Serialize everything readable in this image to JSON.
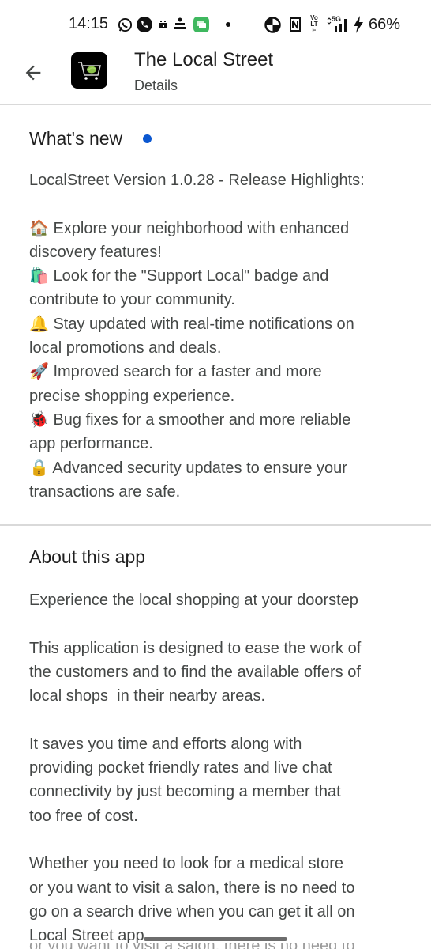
{
  "status_bar": {
    "time": "14:15",
    "left_icons": [
      "whatsapp-icon",
      "phone-call-icon",
      "recorder-icon",
      "game-app-icon",
      "messages-icon",
      "more-notifications-dot-icon"
    ],
    "right_icons": [
      "data-saver-icon",
      "nfc-icon",
      "volte-icon",
      "5g-signal-icon",
      "charging-icon"
    ],
    "network": "5G",
    "volte": "Vo LTE",
    "battery": "66%"
  },
  "header": {
    "app_name": "The Local Street",
    "subtitle": "Details",
    "back_icon": "arrow-back-icon",
    "app_icon": "shopping-cart-icon"
  },
  "whats_new": {
    "title": "What's new",
    "indicator_color": "#0b57d0",
    "intro": "LocalStreet Version 1.0.28 - Release Highlights:",
    "highlights": [
      {
        "emoji": "🏠",
        "lines": [
          "Explore your neighborhood with enhanced",
          "discovery features!"
        ]
      },
      {
        "emoji": "🛍️",
        "lines": [
          "Look for the \"Support Local\" badge and",
          "contribute to your community."
        ]
      },
      {
        "emoji": "🔔",
        "lines": [
          "Stay updated with real-time notifications on",
          "local promotions and deals."
        ]
      },
      {
        "emoji": "🚀",
        "lines": [
          "Improved search for a faster and more",
          "precise shopping experience."
        ]
      },
      {
        "emoji": "🐞",
        "lines": [
          "Bug fixes for a smoother and more reliable",
          "app performance."
        ]
      },
      {
        "emoji": "🔒",
        "lines": [
          "Advanced security updates to ensure your",
          "transactions are safe."
        ]
      }
    ]
  },
  "about": {
    "title": "About this app",
    "tagline": "Experience the local shopping at your doorstep",
    "paragraphs": [
      [
        "This application is designed to ease the work of",
        "the customers and to find the available offers of",
        "local shops  in their nearby areas."
      ],
      [
        "It saves you time and efforts along with",
        "providing pocket friendly rates and live chat",
        "connectivity by just becoming a member that",
        "too free of cost."
      ],
      [
        "Whether you need to look for a medical store",
        "or you want to visit a salon, there is no need to",
        "go on a search drive when you can get it all on",
        "Local Street app."
      ]
    ],
    "cut_off_line": "or you want to visit a salon, there is no need to"
  }
}
